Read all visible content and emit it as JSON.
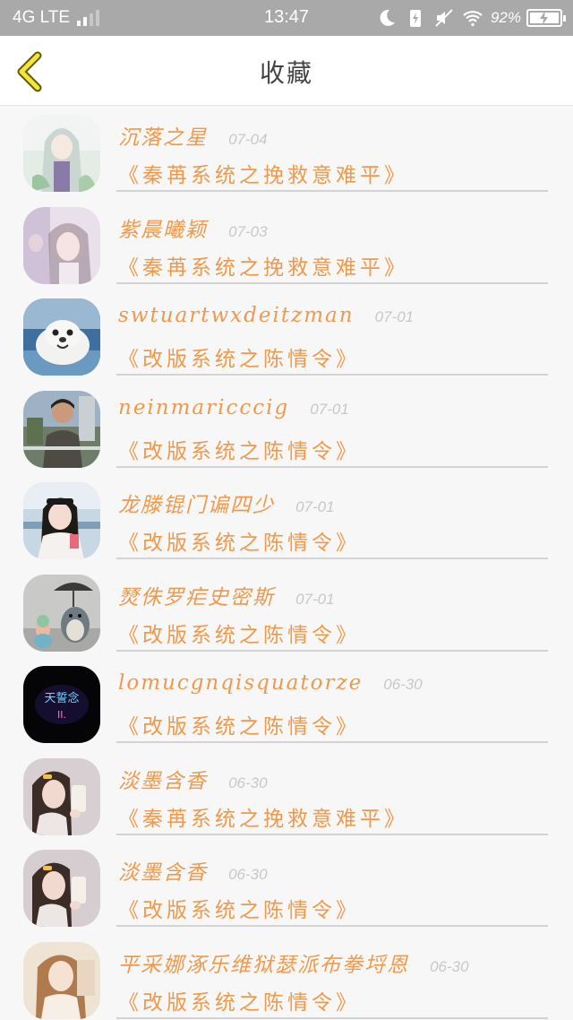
{
  "status_bar": {
    "network": "4G LTE",
    "time": "13:47",
    "battery": "92%"
  },
  "header": {
    "title": "收藏"
  },
  "favorites": [
    {
      "name": "沉落之星",
      "date": "07-04",
      "book": "《秦苒系统之挽救意难平》",
      "avatar": "avatar-1"
    },
    {
      "name": "紫晨曦颖",
      "date": "07-03",
      "book": "《秦苒系统之挽救意难平》",
      "avatar": "avatar-2"
    },
    {
      "name": "swtuartwxdeitzman",
      "date": "07-01",
      "book": "《改版系统之陈情令》",
      "avatar": "avatar-3"
    },
    {
      "name": "neinmaricccig",
      "date": "07-01",
      "book": "《改版系统之陈情令》",
      "avatar": "avatar-4"
    },
    {
      "name": "龙滕锟门谝四少",
      "date": "07-01",
      "book": "《改版系统之陈情令》",
      "avatar": "avatar-5"
    },
    {
      "name": "燹侏罗疟史密斯",
      "date": "07-01",
      "book": "《改版系统之陈情令》",
      "avatar": "avatar-6"
    },
    {
      "name": "lomucgnqisquatorze",
      "date": "06-30",
      "book": "《改版系统之陈情令》",
      "avatar": "avatar-7"
    },
    {
      "name": "淡墨含香",
      "date": "06-30",
      "book": "《秦苒系统之挽救意难平》",
      "avatar": "avatar-8"
    },
    {
      "name": "淡墨含香",
      "date": "06-30",
      "book": "《改版系统之陈情令》",
      "avatar": "avatar-9"
    },
    {
      "name": "平采娜涿乐维狱瑟派布拳埒恩",
      "date": "06-30",
      "book": "《改版系统之陈情令》",
      "avatar": "avatar-10"
    }
  ],
  "avatar_7_text": [
    "天誓念",
    "II."
  ]
}
